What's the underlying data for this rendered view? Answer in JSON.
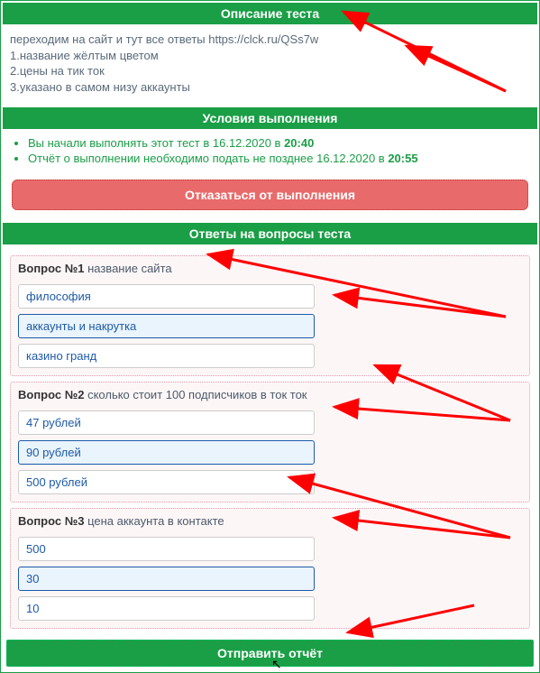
{
  "description": {
    "header": "Описание теста",
    "l1": "переходим на сайт и тут все ответы https://clck.ru/QSs7w",
    "l2": "1.название жёлтым цветом",
    "l3": "2.цены на тик ток",
    "l4": "3.указано в самом низу аккаунты"
  },
  "conditions": {
    "header": "Условия выполнения",
    "li1_a": "Вы начали выполнять этот тест в 16.12.2020 в ",
    "li1_b": "20:40",
    "li2_a": "Отчёт о выполнении необходимо подать не позднее 16.12.2020 в ",
    "li2_b": "20:55",
    "decline": "Отказаться от выполнения"
  },
  "answers": {
    "header": "Ответы на вопросы теста",
    "q1": {
      "num": "Вопрос №1",
      "text": " название сайта",
      "o1": "философия",
      "o2": "аккаунты и накрутка",
      "o3": "казино гранд"
    },
    "q2": {
      "num": "Вопрос №2",
      "text": " сколько стоит 100 подписчиков в ток ток",
      "o1": "47 рублей",
      "o2": "90 рублей",
      "o3": "500 рублей"
    },
    "q3": {
      "num": "Вопрос №3",
      "text": " цена аккаунта в контакте",
      "o1": "500",
      "o2": "30",
      "o3": "10"
    }
  },
  "submit": "Отправить отчёт"
}
